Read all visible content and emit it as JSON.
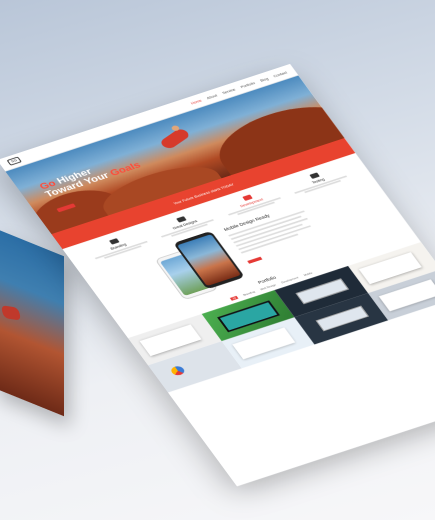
{
  "nav": {
    "logo_text": "SG",
    "items": [
      "Home",
      "About",
      "Service",
      "Portfolio",
      "Blog",
      "Contact"
    ],
    "active_index": 0
  },
  "hero": {
    "title_line1_accent": "Go",
    "title_line1_rest": " Higher",
    "title_line2_start": "Toward Your ",
    "title_line2_accent": "Goals",
    "subtitle": "",
    "button_label": ""
  },
  "banner": {
    "text": "Your Future Business starts TODAY"
  },
  "services": [
    {
      "name": "Branding",
      "active": false
    },
    {
      "name": "Great Designs",
      "active": false
    },
    {
      "name": "Development",
      "active": true
    },
    {
      "name": "Testing",
      "active": false
    }
  ],
  "mobile": {
    "title": "Mobile Design Ready",
    "button_label": ""
  },
  "portfolio": {
    "title": "Portfolio",
    "filters": [
      "All",
      "Branding",
      "Web Design",
      "Development",
      "Mobile"
    ],
    "active_filter": 0
  },
  "colors": {
    "accent": "#e53935",
    "banner": "#e8432f",
    "sky": "#4d8bbf",
    "rock": "#9a3b1c"
  }
}
